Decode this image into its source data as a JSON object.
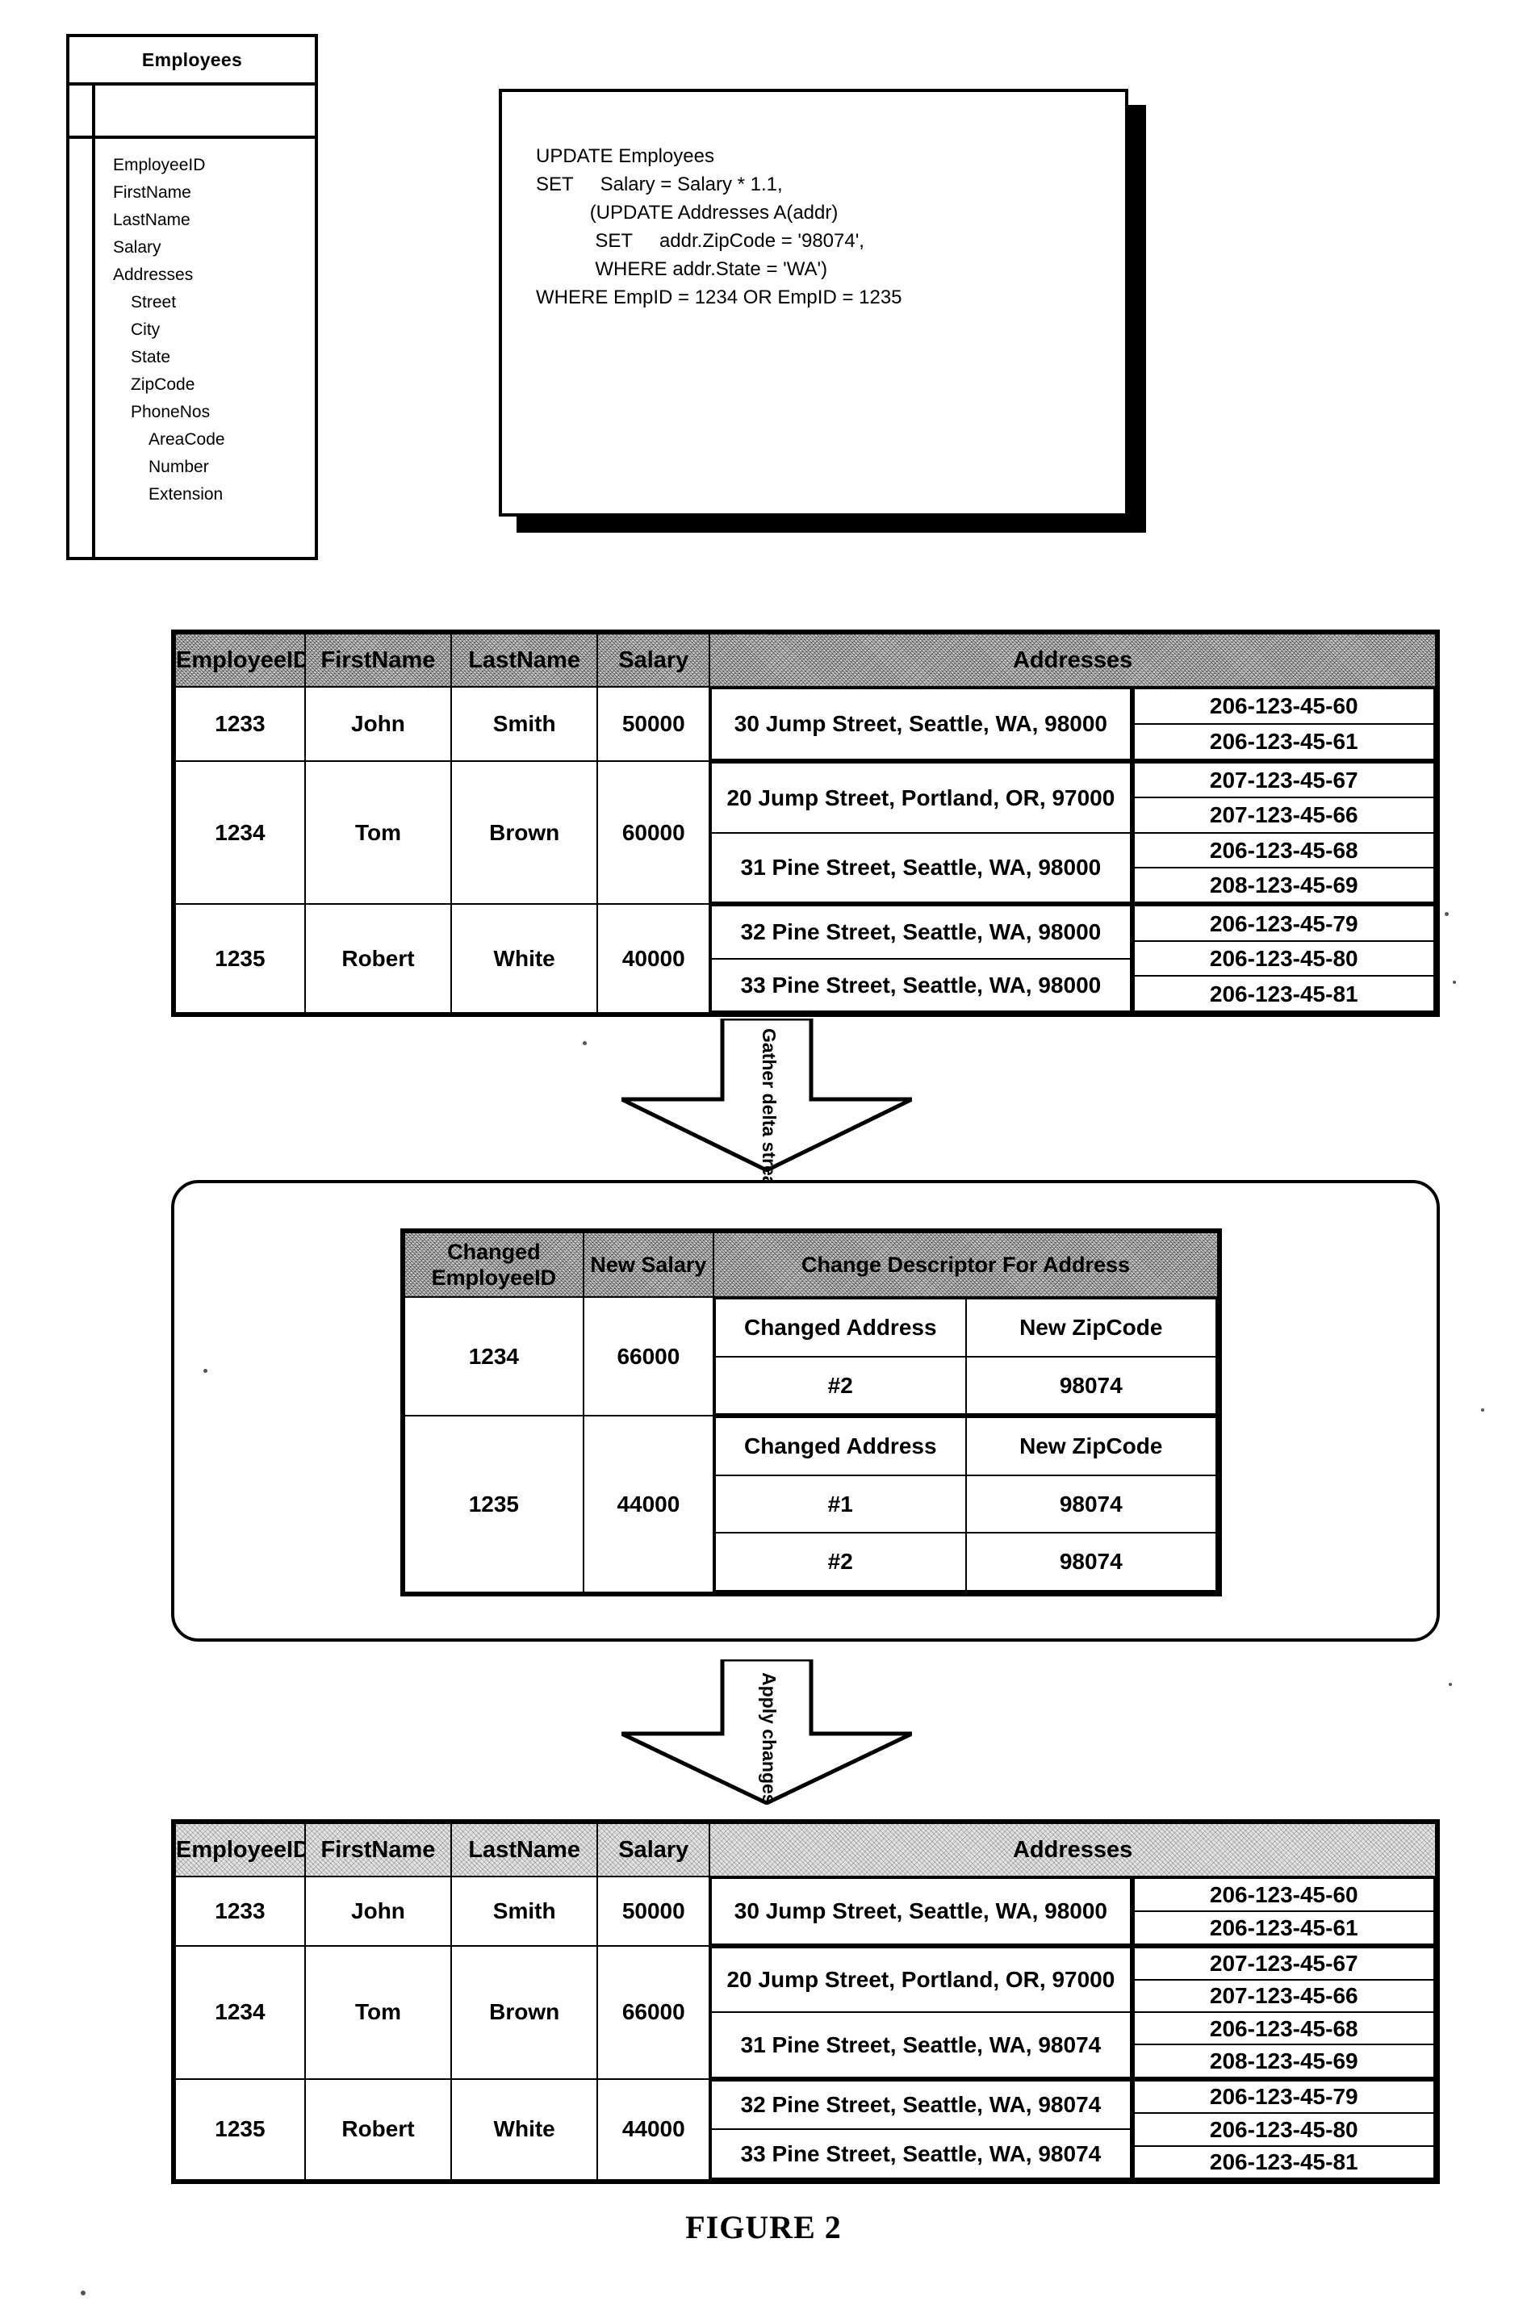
{
  "schema": {
    "title": "Employees",
    "fields": [
      {
        "label": "EmployeeID",
        "indent": 0
      },
      {
        "label": "FirstName",
        "indent": 0
      },
      {
        "label": "LastName",
        "indent": 0
      },
      {
        "label": "Salary",
        "indent": 0
      },
      {
        "label": "Addresses",
        "indent": 0
      },
      {
        "label": "Street",
        "indent": 1
      },
      {
        "label": "City",
        "indent": 1
      },
      {
        "label": "State",
        "indent": 1
      },
      {
        "label": "ZipCode",
        "indent": 1
      },
      {
        "label": "PhoneNos",
        "indent": 1
      },
      {
        "label": "AreaCode",
        "indent": 2
      },
      {
        "label": "Number",
        "indent": 2
      },
      {
        "label": "Extension",
        "indent": 2
      }
    ]
  },
  "sql": {
    "statement": "UPDATE Employees\nSET     Salary = Salary * 1.1,\n          (UPDATE Addresses A(addr)\n           SET     addr.ZipCode = '98074',\n           WHERE addr.State = 'WA')\nWHERE EmpID = 1234 OR EmpID = 1235"
  },
  "arrows": {
    "gather": "Gather delta stream",
    "apply": "Apply changes"
  },
  "before_table": {
    "columns": [
      "EmployeeID",
      "FirstName",
      "LastName",
      "Salary",
      "Addresses"
    ],
    "rows": [
      {
        "employee_id": "1233",
        "first_name": "John",
        "last_name": "Smith",
        "salary": "50000",
        "addresses": [
          {
            "address": "30 Jump Street, Seattle, WA, 98000",
            "phones": [
              "206-123-45-60",
              "206-123-45-61"
            ]
          }
        ]
      },
      {
        "employee_id": "1234",
        "first_name": "Tom",
        "last_name": "Brown",
        "salary": "60000",
        "addresses": [
          {
            "address": "20 Jump Street, Portland, OR, 97000",
            "phones": [
              "207-123-45-67",
              "207-123-45-66"
            ]
          },
          {
            "address": "31 Pine Street, Seattle, WA, 98000",
            "phones": [
              "206-123-45-68",
              "208-123-45-69"
            ]
          }
        ]
      },
      {
        "employee_id": "1235",
        "first_name": "Robert",
        "last_name": "White",
        "salary": "40000",
        "addresses": [
          {
            "address": "32 Pine Street, Seattle, WA, 98000",
            "phones": [
              "206-123-45-79",
              "206-123-45-80"
            ]
          },
          {
            "address": "33 Pine Street, Seattle, WA, 98000",
            "phones": [
              "206-123-45-81"
            ]
          }
        ]
      }
    ]
  },
  "delta_table": {
    "columns": [
      "Changed EmployeeID",
      "New Salary",
      "Change Descriptor For Address"
    ],
    "descriptor_headers": [
      "Changed Address",
      "New ZipCode"
    ],
    "rows": [
      {
        "employee_id": "1234",
        "new_salary": "66000",
        "changes": [
          {
            "changed_address": "#2",
            "new_zipcode": "98074"
          }
        ]
      },
      {
        "employee_id": "1235",
        "new_salary": "44000",
        "changes": [
          {
            "changed_address": "#1",
            "new_zipcode": "98074"
          },
          {
            "changed_address": "#2",
            "new_zipcode": "98074"
          }
        ]
      }
    ]
  },
  "after_table": {
    "columns": [
      "EmployeeID",
      "FirstName",
      "LastName",
      "Salary",
      "Addresses"
    ],
    "rows": [
      {
        "employee_id": "1233",
        "first_name": "John",
        "last_name": "Smith",
        "salary": "50000",
        "addresses": [
          {
            "address": "30 Jump Street, Seattle, WA, 98000",
            "phones": [
              "206-123-45-60",
              "206-123-45-61"
            ]
          }
        ]
      },
      {
        "employee_id": "1234",
        "first_name": "Tom",
        "last_name": "Brown",
        "salary": "66000",
        "addresses": [
          {
            "address": "20 Jump Street, Portland, OR, 97000",
            "phones": [
              "207-123-45-67",
              "207-123-45-66"
            ]
          },
          {
            "address": "31 Pine Street, Seattle, WA, 98074",
            "phones": [
              "206-123-45-68",
              "208-123-45-69"
            ]
          }
        ]
      },
      {
        "employee_id": "1235",
        "first_name": "Robert",
        "last_name": "White",
        "salary": "44000",
        "addresses": [
          {
            "address": "32 Pine Street, Seattle, WA, 98074",
            "phones": [
              "206-123-45-79",
              "206-123-45-80"
            ]
          },
          {
            "address": "33 Pine Street, Seattle, WA, 98074",
            "phones": [
              "206-123-45-81"
            ]
          }
        ]
      }
    ]
  },
  "figure": {
    "caption": "FIGURE 2"
  }
}
